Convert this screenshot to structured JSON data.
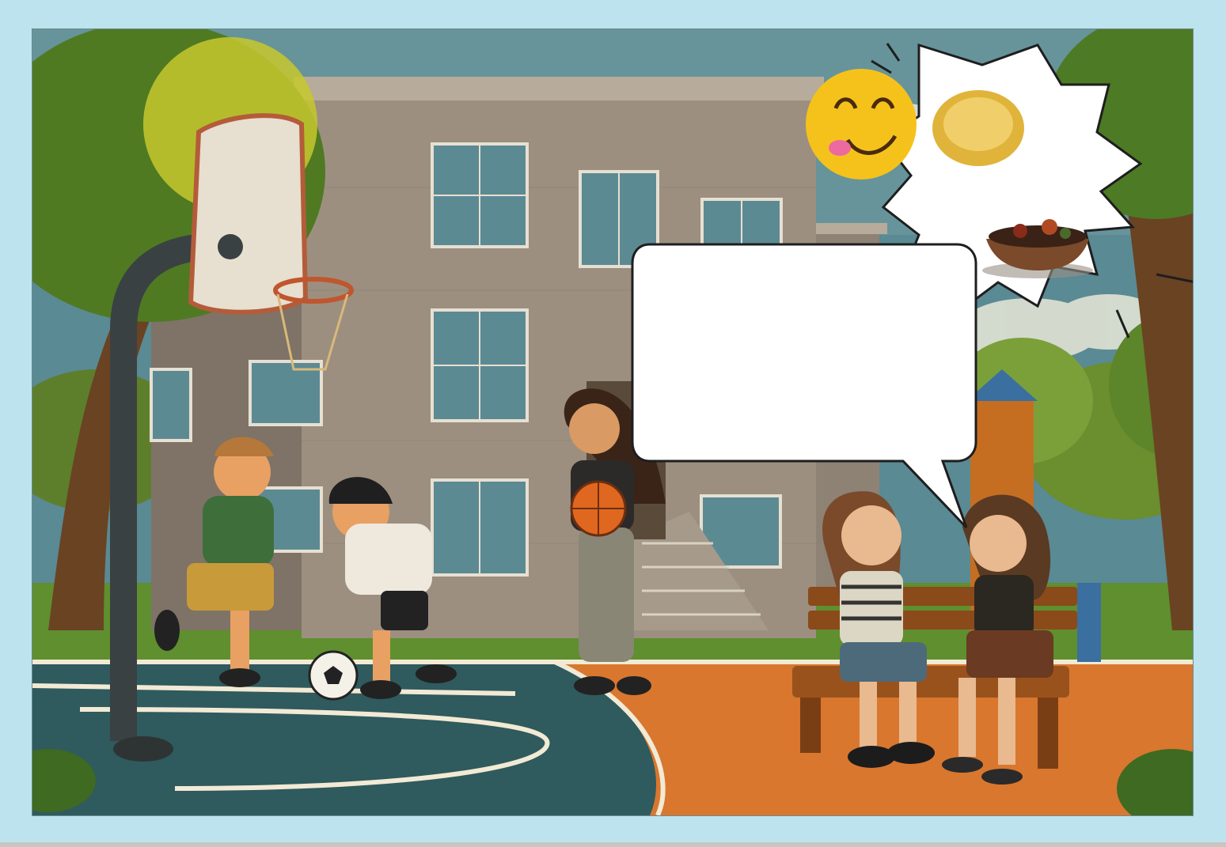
{
  "colors": {
    "page_background": "#bde4ee",
    "sky": "#5a8a93",
    "court_orange": "#d9772e",
    "court_blue": "#2f5a5e",
    "court_line": "#f2ead4",
    "grass": "#5f8f2e",
    "building": "#9c8f80",
    "window": "#5c8a93",
    "speech_bubble": "#ffffff"
  },
  "icons": {
    "emoji": "yum-face-emoji-icon",
    "food_1": "fried-noodles-icon",
    "food_2": "meat-stew-bowl-icon",
    "ball_1": "basketball-icon",
    "ball_2": "soccer-ball-icon"
  },
  "speech_bubble": {
    "text": ""
  }
}
